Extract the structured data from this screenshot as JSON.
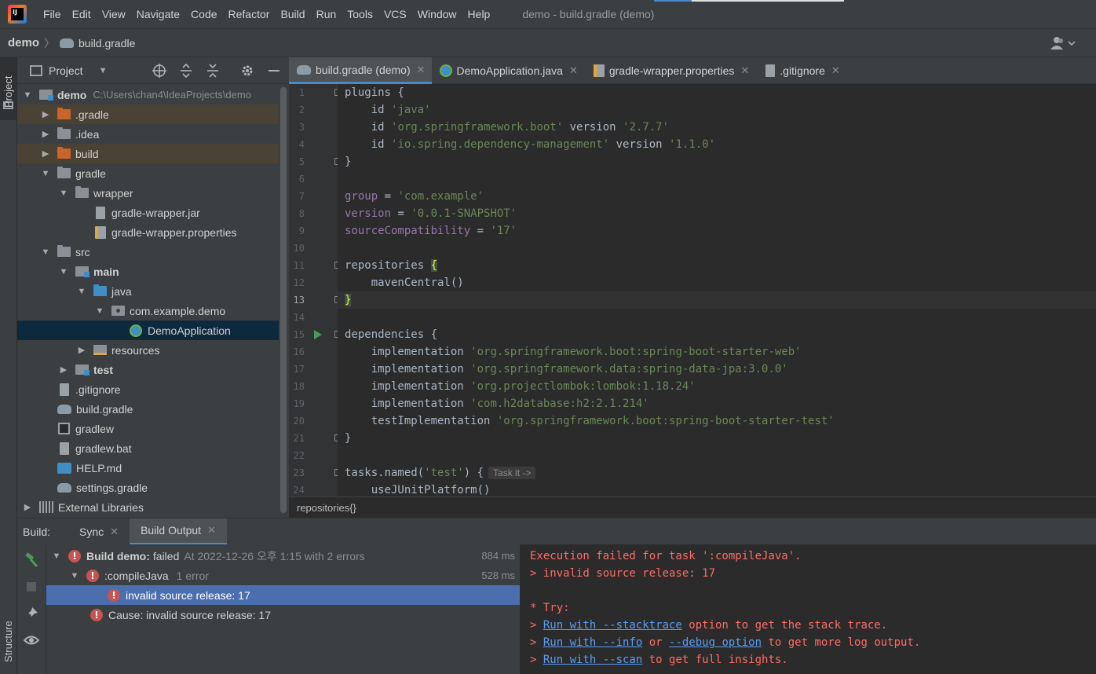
{
  "menubar": {
    "items": [
      "File",
      "Edit",
      "View",
      "Navigate",
      "Code",
      "Refactor",
      "Build",
      "Run",
      "Tools",
      "VCS",
      "Window",
      "Help"
    ],
    "window_title": "demo - build.gradle (demo)"
  },
  "navbar": {
    "project": "demo",
    "file": "build.gradle"
  },
  "left_strip": {
    "project_label": "Project",
    "structure_label": "Structure"
  },
  "project_panel": {
    "title": "Project",
    "tree": [
      {
        "name": "demo",
        "path": "C:\\Users\\chan4\\IdeaProjects\\demo"
      },
      {
        "name": ".gradle"
      },
      {
        "name": ".idea"
      },
      {
        "name": "build"
      },
      {
        "name": "gradle"
      },
      {
        "name": "wrapper"
      },
      {
        "name": "gradle-wrapper.jar"
      },
      {
        "name": "gradle-wrapper.properties"
      },
      {
        "name": "src"
      },
      {
        "name": "main"
      },
      {
        "name": "java"
      },
      {
        "name": "com.example.demo"
      },
      {
        "name": "DemoApplication"
      },
      {
        "name": "resources"
      },
      {
        "name": "test"
      },
      {
        "name": ".gitignore"
      },
      {
        "name": "build.gradle"
      },
      {
        "name": "gradlew"
      },
      {
        "name": "gradlew.bat"
      },
      {
        "name": "HELP.md"
      },
      {
        "name": "settings.gradle"
      },
      {
        "name": "External Libraries"
      }
    ]
  },
  "editor": {
    "tabs": [
      "build.gradle (demo)",
      "DemoApplication.java",
      "gradle-wrapper.properties",
      ".gitignore"
    ],
    "line_numbers": [
      "1",
      "2",
      "3",
      "4",
      "5",
      "6",
      "7",
      "8",
      "9",
      "10",
      "11",
      "12",
      "13",
      "14",
      "15",
      "16",
      "17",
      "18",
      "19",
      "20",
      "21",
      "22",
      "23",
      "24"
    ],
    "code": {
      "l1": "plugins {",
      "l2a": "    id ",
      "l2b": "'java'",
      "l3a": "    id ",
      "l3b": "'org.springframework.boot'",
      "l3c": " version ",
      "l3d": "'2.7.7'",
      "l4a": "    id ",
      "l4b": "'io.spring.dependency-management'",
      "l4c": " version ",
      "l4d": "'1.1.0'",
      "l5": "}",
      "l7a": "group",
      "l7b": " = ",
      "l7c": "'com.example'",
      "l8a": "version",
      "l8b": " = ",
      "l8c": "'0.0.1-SNAPSHOT'",
      "l9a": "sourceCompatibility",
      "l9b": " = ",
      "l9c": "'17'",
      "l11a": "repositories ",
      "l11b": "{",
      "l12": "    mavenCentral()",
      "l13": "}",
      "l15": "dependencies {",
      "l16a": "    implementation ",
      "l16b": "'org.springframework.boot:spring-boot-starter-web'",
      "l17a": "    implementation ",
      "l17b": "'org.springframework.data:spring-data-jpa:3.0.0'",
      "l18a": "    implementation ",
      "l18b": "'org.projectlombok:lombok:1.18.24'",
      "l19a": "    implementation ",
      "l19b": "'com.h2database:h2:2.1.214'",
      "l20a": "    testImplementation ",
      "l20b": "'org.springframework.boot:spring-boot-starter-test'",
      "l21": "}",
      "l23a": "tasks.named(",
      "l23b": "'test'",
      "l23c": ") {",
      "l23hint": "Task it ->",
      "l24": "    useJUnitPlatform()"
    },
    "breadcrumb": "repositories{}"
  },
  "build": {
    "title": "Build:",
    "tabs": [
      "Sync",
      "Build Output"
    ],
    "rows": [
      {
        "name": "Build demo:",
        "status": "failed",
        "meta": "At 2022-12-26 오후 1:15 with 2 errors",
        "time": "884 ms"
      },
      {
        "name": ":compileJava",
        "meta": "1 error",
        "time": "528 ms"
      },
      {
        "name": "invalid source release: 17"
      },
      {
        "name": "Cause: invalid source release: 17"
      }
    ],
    "console": {
      "line1": "Execution failed for task ':compileJava'.",
      "line2": "> invalid source release: 17",
      "line4": "* Try:",
      "line5_pre": "> ",
      "line5_link": "Run with --stacktrace",
      "line5_post": " option to get the stack trace.",
      "line6_pre": "> ",
      "line6_link1": "Run with --info",
      "line6_mid": " or ",
      "line6_link2": "--debug option",
      "line6_post": " to get more log output.",
      "line7_pre": "> ",
      "line7_link": "Run with --scan",
      "line7_post": " to get full insights."
    }
  },
  "colors": {
    "accent": "#4a88c7",
    "error": "#c75450",
    "console_error": "#ff6b68",
    "link": "#589df6",
    "string": "#6a8759"
  }
}
